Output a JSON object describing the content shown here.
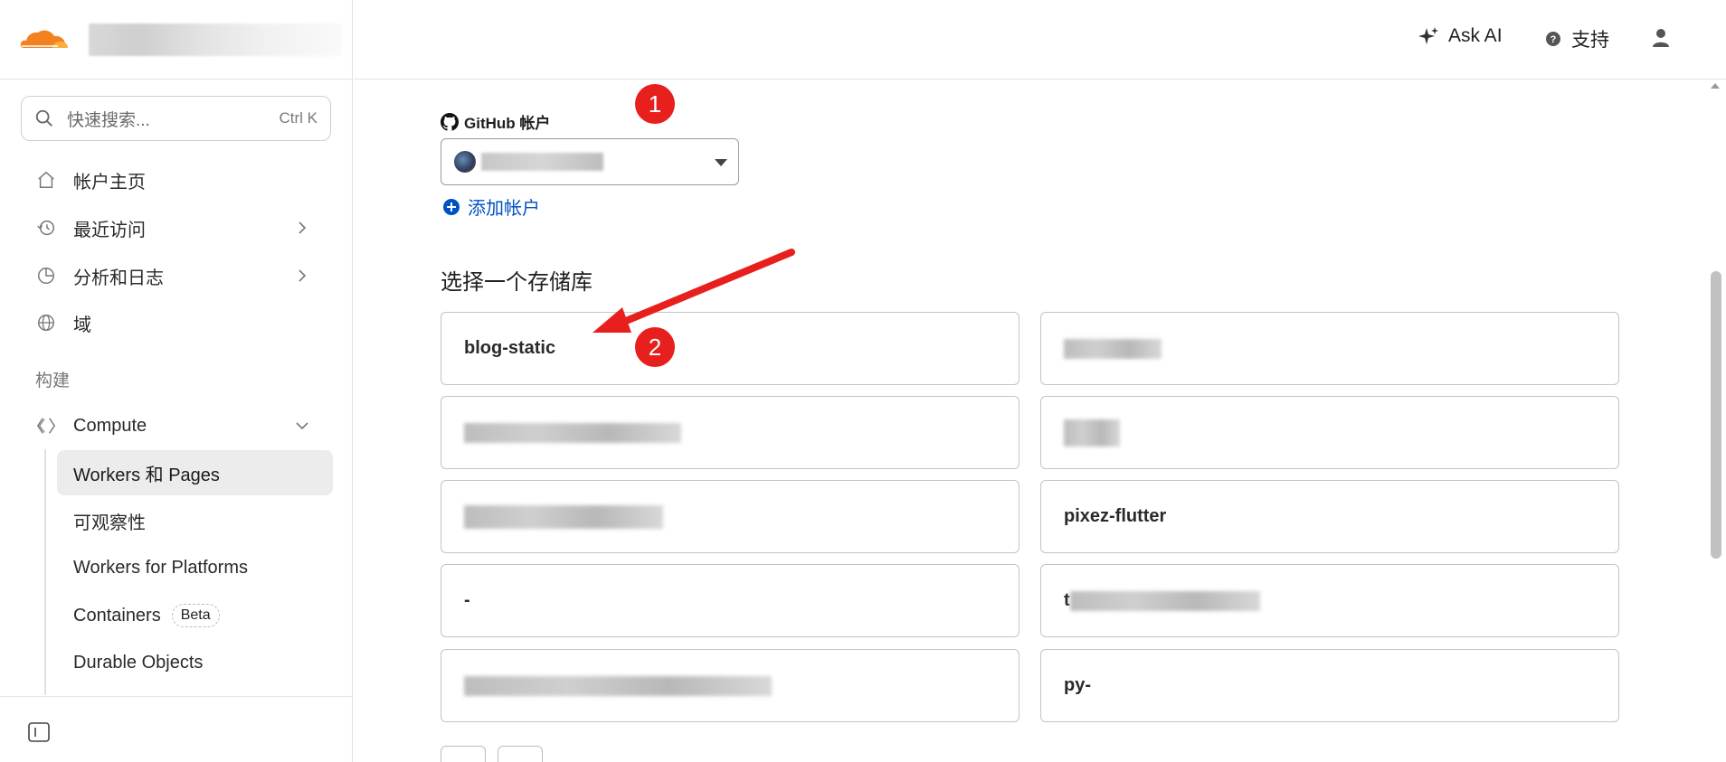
{
  "colors": {
    "brand_orange": "#f48120",
    "link_blue": "#0051c3",
    "annotation_red": "#e8201d"
  },
  "sidebar": {
    "search": {
      "placeholder": "快速搜索...",
      "shortcut": "Ctrl K"
    },
    "items": [
      {
        "label": "帐户主页",
        "icon": "home-icon"
      },
      {
        "label": "最近访问",
        "icon": "history-icon"
      },
      {
        "label": "分析和日志",
        "icon": "pie-chart-icon"
      },
      {
        "label": "域",
        "icon": "globe-icon"
      }
    ],
    "section_label": "构建",
    "compute": {
      "label": "Compute",
      "icon": "diamond-icon"
    },
    "subitems": [
      {
        "label": "Workers 和 Pages",
        "active": true
      },
      {
        "label": "可观察性"
      },
      {
        "label": "Workers for Platforms"
      },
      {
        "label": "Containers",
        "badge": "Beta"
      },
      {
        "label": "Durable Objects"
      }
    ]
  },
  "header": {
    "ask_ai": "Ask AI",
    "support": "支持"
  },
  "main": {
    "github_label": "GitHub 帐户",
    "add_account": "添加帐户",
    "choose_repo_title": "选择一个存储库",
    "repos": [
      {
        "name": "blog-static"
      },
      {
        "name": ""
      },
      {
        "name": ""
      },
      {
        "name": ""
      },
      {
        "name": ""
      },
      {
        "name": "pixez-flutter"
      },
      {
        "name": "-"
      },
      {
        "name": "t"
      },
      {
        "name": ""
      },
      {
        "name": "py-"
      }
    ]
  },
  "annotations": {
    "marker1": "1",
    "marker2": "2"
  }
}
